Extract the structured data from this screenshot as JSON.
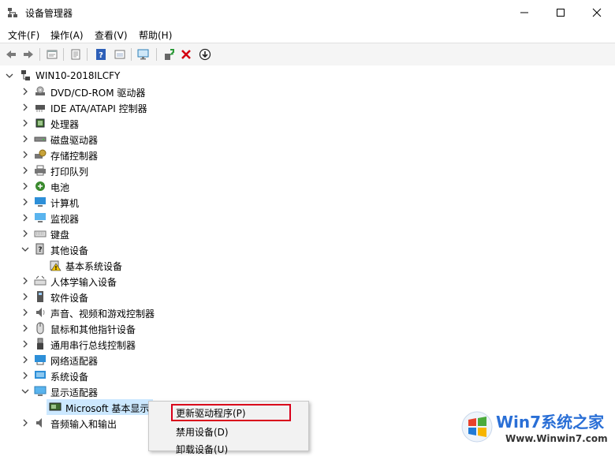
{
  "window": {
    "title": "设备管理器"
  },
  "menu": [
    "文件(F)",
    "操作(A)",
    "查看(V)",
    "帮助(H)"
  ],
  "toolbar": {
    "icons": [
      "back-arrow-icon",
      "forward-arrow-icon",
      "properties-icon",
      "print-icon",
      "help-icon",
      "view-icon",
      "monitor-scan-icon",
      "update-driver-icon",
      "uninstall-icon",
      "download-icon"
    ]
  },
  "tree": {
    "root": "WIN10-2018ILCFY",
    "items": [
      {
        "label": "DVD/CD-ROM 驱动器",
        "icon": "dvd-icon",
        "state": "collapsed"
      },
      {
        "label": "IDE ATA/ATAPI 控制器",
        "icon": "ide-controller-icon",
        "state": "collapsed"
      },
      {
        "label": "处理器",
        "icon": "processor-icon",
        "state": "collapsed"
      },
      {
        "label": "磁盘驱动器",
        "icon": "disk-icon",
        "state": "collapsed"
      },
      {
        "label": "存储控制器",
        "icon": "storage-icon",
        "state": "collapsed"
      },
      {
        "label": "打印队列",
        "icon": "printer-icon",
        "state": "collapsed"
      },
      {
        "label": "电池",
        "icon": "battery-icon",
        "state": "collapsed"
      },
      {
        "label": "计算机",
        "icon": "computer-icon",
        "state": "collapsed"
      },
      {
        "label": "监视器",
        "icon": "monitor-icon",
        "state": "collapsed"
      },
      {
        "label": "键盘",
        "icon": "keyboard-icon",
        "state": "collapsed"
      },
      {
        "label": "其他设备",
        "icon": "other-device-icon",
        "state": "expanded"
      },
      {
        "label": "基本系统设备",
        "icon": "warning-device-icon",
        "state": "child"
      },
      {
        "label": "人体学输入设备",
        "icon": "hid-icon",
        "state": "collapsed"
      },
      {
        "label": "软件设备",
        "icon": "software-icon",
        "state": "collapsed"
      },
      {
        "label": "声音、视频和游戏控制器",
        "icon": "speaker-icon",
        "state": "collapsed"
      },
      {
        "label": "鼠标和其他指针设备",
        "icon": "mouse-icon",
        "state": "collapsed"
      },
      {
        "label": "通用串行总线控制器",
        "icon": "usb-icon",
        "state": "collapsed"
      },
      {
        "label": "网络适配器",
        "icon": "network-icon",
        "state": "collapsed"
      },
      {
        "label": "系统设备",
        "icon": "system-icon",
        "state": "collapsed"
      },
      {
        "label": "显示适配器",
        "icon": "display-adapter-icon",
        "state": "expanded"
      },
      {
        "label": "Microsoft 基本显示",
        "icon": "display-card-icon",
        "state": "child-selected"
      },
      {
        "label": "音频输入和输出",
        "icon": "audio-icon",
        "state": "collapsed"
      }
    ]
  },
  "context_menu": {
    "items": [
      "更新驱动程序(P)",
      "禁用设备(D)",
      "卸载设备(U)"
    ],
    "highlight_color": "#d9001b"
  },
  "watermark": {
    "name": "Win7系统之家",
    "url": "Www.Winwin7.com"
  },
  "colors": {
    "selection": "#cce8ff",
    "accent": "#2a6fd6"
  }
}
